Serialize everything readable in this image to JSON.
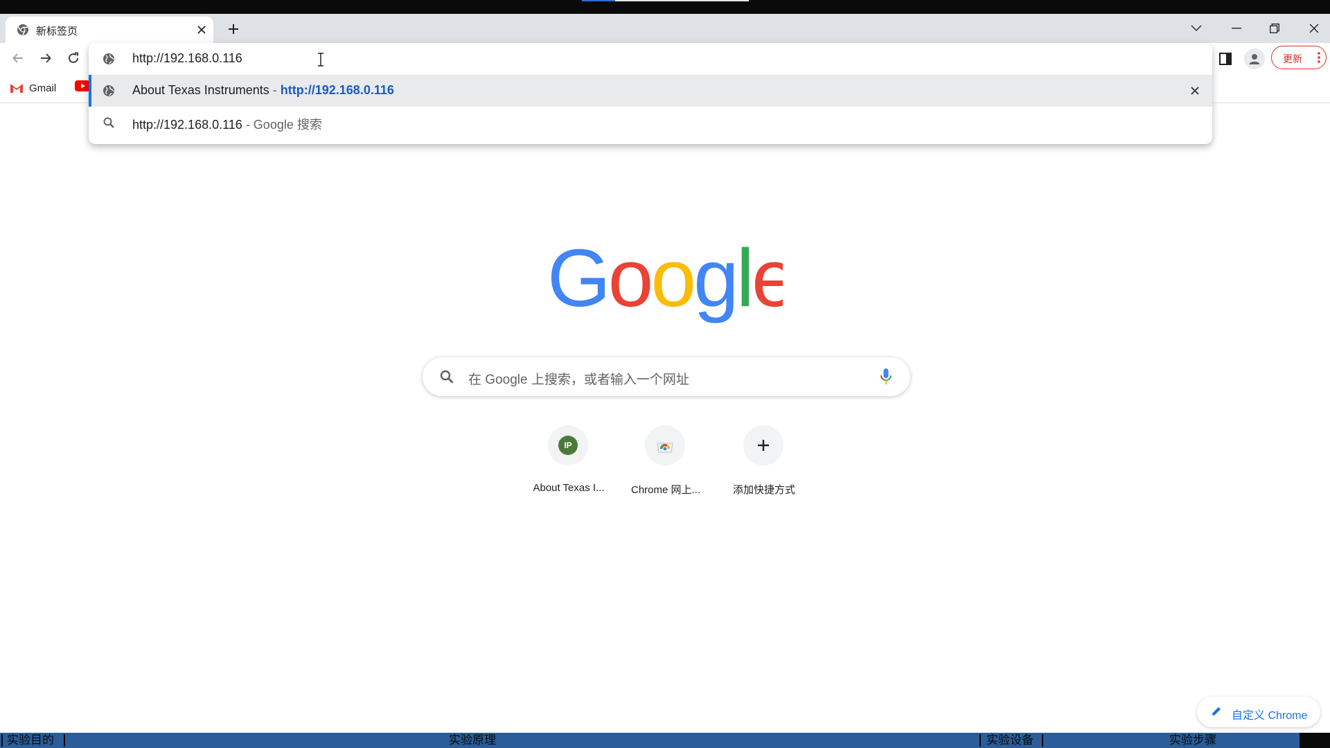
{
  "browser": {
    "tab": {
      "title": "新标签页"
    },
    "omnibox": {
      "value": "http://192.168.0.116"
    },
    "update_button": {
      "label": "更新"
    }
  },
  "bookmarks": [
    {
      "label": "Gmail",
      "icon": "gmail-icon"
    },
    {
      "label": "",
      "icon": "youtube-icon"
    }
  ],
  "omnibox_popup": {
    "suggestions": [
      {
        "icon": "globe-icon",
        "title": "About Texas Instruments",
        "separator": " - ",
        "url": "http://192.168.0.116"
      },
      {
        "icon": "search-icon",
        "query": "http://192.168.0.116",
        "suffix": " - Google 搜索"
      }
    ]
  },
  "ntp": {
    "logo": "Google",
    "search_placeholder": "在 Google 上搜索，或者输入一个网址",
    "shortcuts": [
      {
        "label": "About Texas I...",
        "badge": "IP",
        "badge_color": "#4a7a3a"
      },
      {
        "label": "Chrome 网上...",
        "icon": "chrome-web-store-icon"
      },
      {
        "label": "添加快捷方式",
        "icon": "plus-icon"
      }
    ],
    "customize_label": "自定义 Chrome"
  },
  "taskbar": {
    "items": [
      "实验目的",
      "实验原理",
      "实验设备",
      "实验步骤"
    ]
  },
  "colors": {
    "accent": "#1a73e8",
    "update_red": "#d93025",
    "taskbar_blue": "#2a5d9a",
    "google_blue": "#4285f4",
    "google_red": "#ea4335",
    "google_yellow": "#fbbc05",
    "google_green": "#34a853"
  }
}
